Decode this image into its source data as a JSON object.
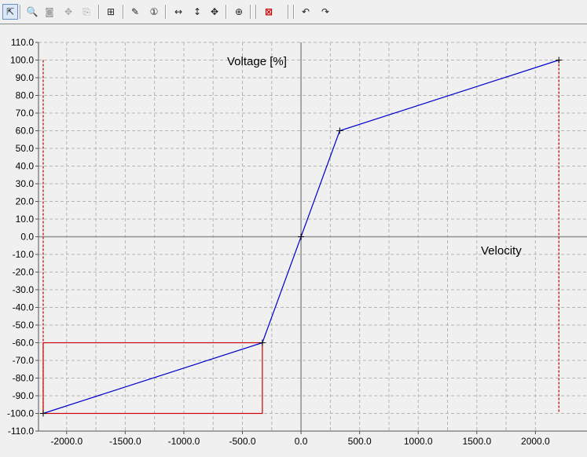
{
  "toolbar": {
    "buttons": [
      {
        "name": "pointer-tool",
        "icon": "pointer-icon",
        "glyph": "⇱",
        "active": true,
        "disabled": false
      },
      {
        "name": "zoom-in",
        "icon": "zoom-icon",
        "glyph": "🔍",
        "active": false,
        "disabled": false
      },
      {
        "name": "zoom-disabled",
        "icon": "zoom-area-icon",
        "glyph": "◙",
        "active": false,
        "disabled": true
      },
      {
        "name": "pan-disabled",
        "icon": "pan-icon",
        "glyph": "✥",
        "active": false,
        "disabled": true
      },
      {
        "name": "export-disabled",
        "icon": "export-icon",
        "glyph": "⎘",
        "active": false,
        "disabled": true
      },
      {
        "name": "grid-toggle",
        "icon": "grid-icon",
        "glyph": "⊞",
        "active": false,
        "disabled": false
      },
      {
        "name": "draw-line",
        "icon": "pen-icon",
        "glyph": "✎",
        "active": false,
        "disabled": false
      },
      {
        "name": "marker-one",
        "icon": "numbered-marker-icon",
        "glyph": "①",
        "active": false,
        "disabled": false
      },
      {
        "name": "fit-horizontal",
        "icon": "horizontal-arrows-icon",
        "glyph": "↔",
        "active": false,
        "disabled": false
      },
      {
        "name": "fit-vertical",
        "icon": "vertical-arrows-icon",
        "glyph": "↕",
        "active": false,
        "disabled": false
      },
      {
        "name": "fit-both",
        "icon": "four-way-arrows-icon",
        "glyph": "✥",
        "active": false,
        "disabled": false
      },
      {
        "name": "center-view",
        "icon": "target-icon",
        "glyph": "⊕",
        "active": false,
        "disabled": false
      },
      {
        "name": "clear-plot",
        "icon": "clear-icon",
        "glyph": "⊠",
        "active": false,
        "disabled": false
      },
      {
        "name": "undo",
        "icon": "undo-icon",
        "glyph": "↶",
        "active": false,
        "disabled": false
      },
      {
        "name": "redo",
        "icon": "redo-icon",
        "glyph": "↷",
        "active": false,
        "disabled": false
      }
    ]
  },
  "chart_data": {
    "type": "line",
    "title": "",
    "xlabel": "Velocity",
    "ylabel": "Voltage [%]",
    "xlim": [
      -2240,
      2440
    ],
    "ylim": [
      -110,
      110
    ],
    "x_ticks": [
      -2000.0,
      -1500.0,
      -1000.0,
      -500.0,
      0.0,
      500.0,
      1000.0,
      1500.0,
      2000.0
    ],
    "x_tick_labels": [
      "-2000.0",
      "-1500.0",
      "-1000.0",
      "-500.0",
      "0.0",
      "500.0",
      "1000.0",
      "1500.0",
      "2000.0"
    ],
    "y_ticks": [
      110,
      100,
      90,
      80,
      70,
      60,
      50,
      40,
      30,
      20,
      10,
      0,
      -10,
      -20,
      -30,
      -40,
      -50,
      -60,
      -70,
      -80,
      -90,
      -100,
      -110
    ],
    "y_tick_labels": [
      "110.0",
      "100.0",
      "90.0",
      "80.0",
      "70.0",
      "60.0",
      "50.0",
      "40.0",
      "30.0",
      "20.0",
      "10.0",
      "0.0",
      "-10.0",
      "-20.0",
      "-30.0",
      "-40.0",
      "-50.0",
      "-60.0",
      "-70.0",
      "-80.0",
      "-90.0",
      "-100.0",
      "-110.0"
    ],
    "grid": true,
    "series": [
      {
        "color": "#0000cc",
        "x": [
          -2200,
          -330,
          0,
          330,
          2200
        ],
        "y": [
          -100,
          -60,
          0,
          60,
          100
        ]
      }
    ],
    "vertical_limits": {
      "x": [
        -2200,
        2200
      ],
      "y_range": [
        -100,
        100
      ],
      "color": "#aa0000"
    },
    "selection_rect": {
      "x": [
        -2200,
        -330
      ],
      "y": [
        -100,
        -60
      ],
      "color": "#cc0000"
    },
    "colors": {
      "axis": "#909090",
      "grid": "#b4b4b4",
      "plot_bg": "#f0f0f0"
    }
  }
}
